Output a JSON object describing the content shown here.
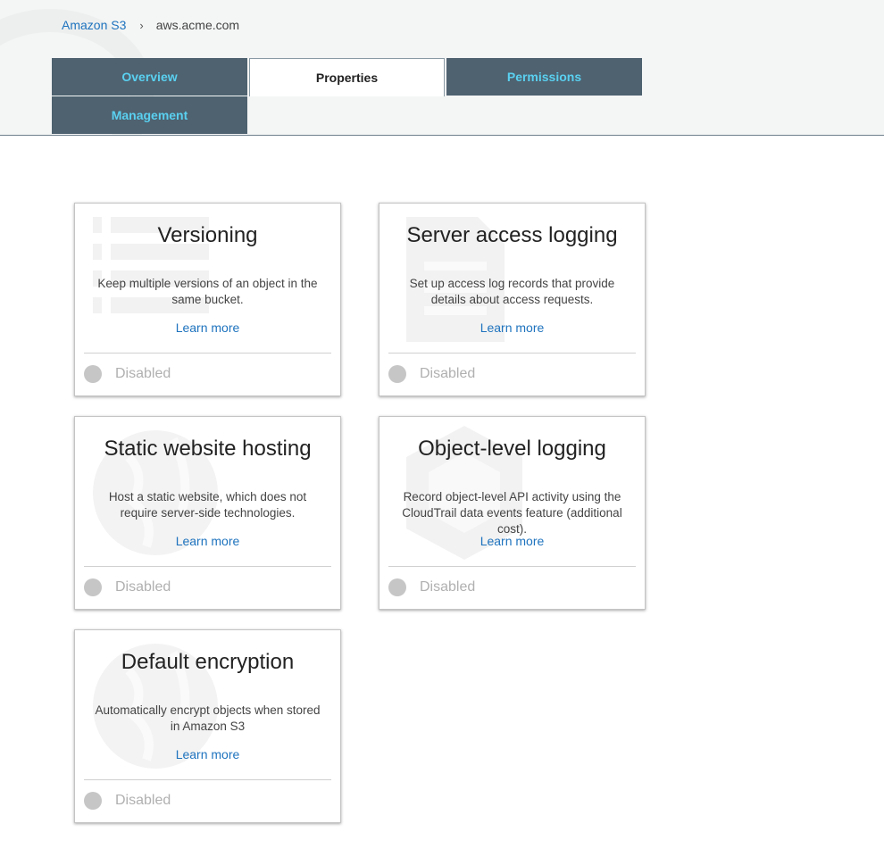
{
  "breadcrumb": {
    "root": "Amazon S3",
    "separator": "›",
    "current": "aws.acme.com"
  },
  "tabs": [
    {
      "label": "Overview",
      "active": false
    },
    {
      "label": "Properties",
      "active": true
    },
    {
      "label": "Permissions",
      "active": false
    },
    {
      "label": "Management",
      "active": false
    }
  ],
  "cards": [
    {
      "title": "Versioning",
      "description": "Keep multiple versions of an object in the same bucket.",
      "link": "Learn more",
      "status": "Disabled",
      "icon": "list-icon"
    },
    {
      "title": "Server access logging",
      "description": "Set up access log records that provide details about access requests.",
      "link": "Learn more",
      "status": "Disabled",
      "icon": "document-icon"
    },
    {
      "title": "Static website hosting",
      "description": "Host a static website, which does not require server-side technologies.",
      "link": "Learn more",
      "status": "Disabled",
      "icon": "globe-icon"
    },
    {
      "title": "Object-level logging",
      "description": "Record object-level API activity using the CloudTrail data events feature (additional cost).",
      "link": "Learn more",
      "status": "Disabled",
      "icon": "cloudtrail-icon"
    },
    {
      "title": "Default encryption",
      "description": "Automatically encrypt objects when stored in Amazon S3",
      "link": "Learn more",
      "status": "Disabled",
      "icon": "globe-icon"
    }
  ],
  "colors": {
    "tab_bg": "#4e6270",
    "tab_text": "#5ad0f0",
    "link": "#1e73be",
    "status_dot": "#c6c6c6"
  }
}
